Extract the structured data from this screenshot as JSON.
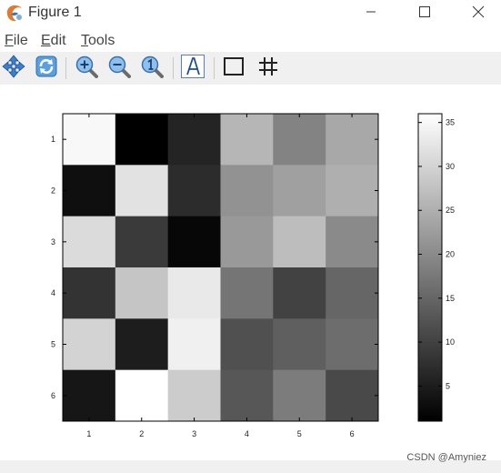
{
  "window": {
    "title": "Figure 1",
    "minimize_icon": "minimize-icon",
    "maximize_icon": "maximize-icon",
    "close_icon": "close-icon"
  },
  "menu": {
    "file_first": "F",
    "file_rest": "ile",
    "edit_first": "E",
    "edit_rest": "dit",
    "tools_first": "T",
    "tools_rest": "ools"
  },
  "toolbar": {
    "tools": [
      "pan-icon",
      "rotate-icon",
      "zoom-in-icon",
      "zoom-out-icon",
      "zoom-reset-icon",
      "text-insert-icon",
      "box-toggle-icon",
      "grid-toggle-icon"
    ]
  },
  "chart_data": {
    "type": "heatmap",
    "colormap": "gray",
    "x_categories": [
      "1",
      "2",
      "3",
      "4",
      "5",
      "6"
    ],
    "y_categories": [
      "1",
      "2",
      "3",
      "4",
      "5",
      "6"
    ],
    "values": [
      [
        35,
        1,
        6,
        26,
        19,
        24
      ],
      [
        3,
        32,
        7,
        21,
        23,
        25
      ],
      [
        31,
        9,
        2,
        22,
        27,
        20
      ],
      [
        8,
        28,
        33,
        17,
        10,
        15
      ],
      [
        30,
        5,
        34,
        12,
        14,
        16
      ],
      [
        4,
        36,
        29,
        13,
        18,
        11
      ]
    ],
    "clim": [
      1,
      36
    ],
    "colorbar_ticks": [
      "5",
      "10",
      "15",
      "20",
      "25",
      "30",
      "35"
    ]
  },
  "watermark": "CSDN @Amyniez"
}
